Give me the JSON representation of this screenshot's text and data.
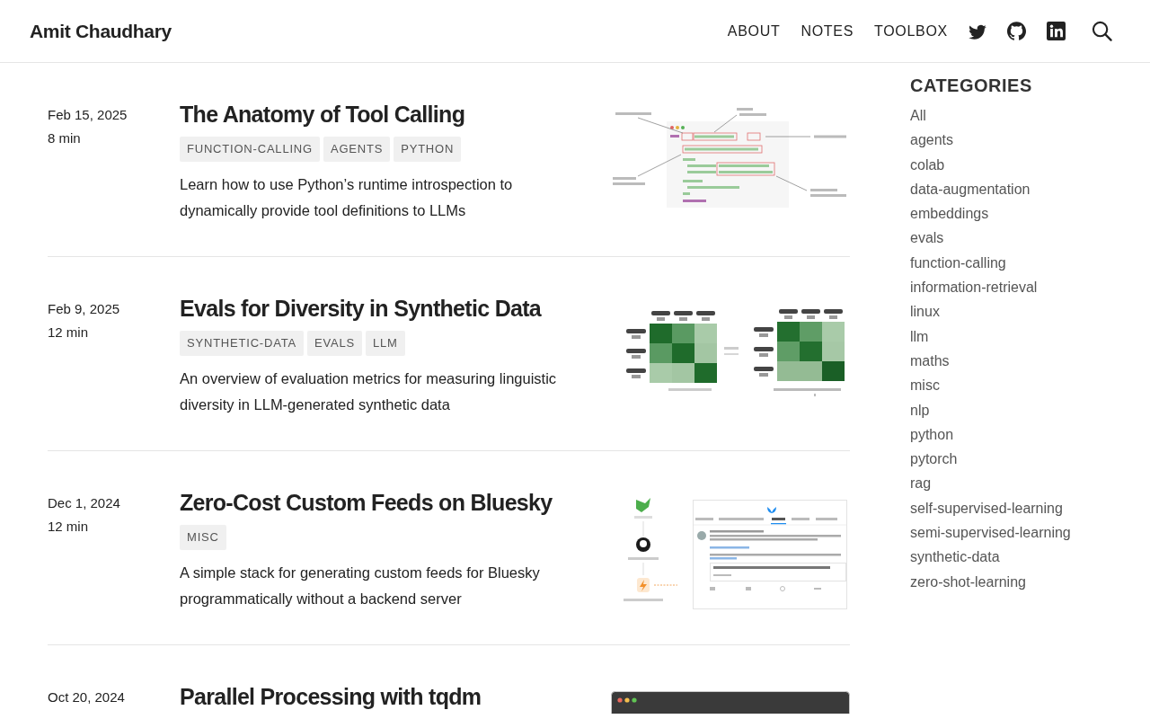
{
  "header": {
    "brand": "Amit Chaudhary",
    "nav": [
      "ABOUT",
      "NOTES",
      "TOOLBOX"
    ]
  },
  "posts": [
    {
      "date": "Feb 15, 2025",
      "read_time": "8 min",
      "title": "The Anatomy of Tool Calling",
      "tags": [
        "FUNCTION-CALLING",
        "AGENTS",
        "PYTHON"
      ],
      "description": "Learn how to use Python’s runtime introspection to dynamically provide tool definitions to LLMs",
      "thumbnail": {
        "kind": "code"
      }
    },
    {
      "date": "Feb 9, 2025",
      "read_time": "12 min",
      "title": "Evals for Diversity in Synthetic Data",
      "tags": [
        "SYNTHETIC-DATA",
        "EVALS",
        "LLM"
      ],
      "description": "An overview of evaluation metrics for measuring linguistic diversity in LLM-generated synthetic data",
      "thumbnail": {
        "kind": "heatmap"
      }
    },
    {
      "date": "Dec 1, 2024",
      "read_time": "12 min",
      "title": "Zero-Cost Custom Feeds on Bluesky",
      "tags": [
        "MISC"
      ],
      "description": "A simple stack for generating custom feeds for Bluesky programmatically without a backend server",
      "thumbnail": {
        "kind": "feed"
      }
    },
    {
      "date": "Oct 20, 2024",
      "title": "Parallel Processing with tqdm",
      "thumbnail": {
        "kind": "terminal"
      }
    }
  ],
  "sidebar": {
    "heading": "CATEGORIES",
    "items": [
      "All",
      "agents",
      "colab",
      "data-augmentation",
      "embeddings",
      "evals",
      "function-calling",
      "information-retrieval",
      "linux",
      "llm",
      "maths",
      "misc",
      "nlp",
      "python",
      "pytorch",
      "rag",
      "self-supervised-learning",
      "semi-supervised-learning",
      "synthetic-data",
      "zero-shot-learning"
    ]
  }
}
